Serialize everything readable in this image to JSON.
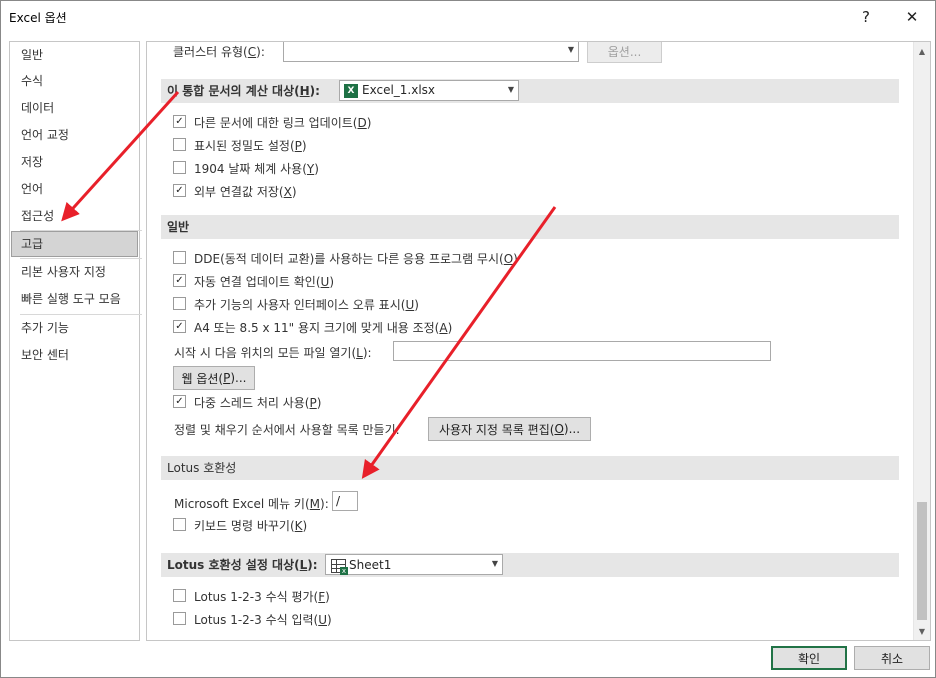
{
  "window": {
    "title": "Excel 옵션",
    "help_glyph": "?",
    "close_glyph": "✕"
  },
  "sidebar": {
    "items": [
      {
        "label": "일반"
      },
      {
        "label": "수식"
      },
      {
        "label": "데이터"
      },
      {
        "label": "언어 교정"
      },
      {
        "label": "저장"
      },
      {
        "label": "언어"
      },
      {
        "label": "접근성"
      },
      {
        "label": "고급",
        "active": true
      },
      {
        "label": "리본 사용자 지정"
      },
      {
        "label": "빠른 실행 도구 모음"
      },
      {
        "label": "추가 기능"
      },
      {
        "label": "보안 센터"
      }
    ]
  },
  "cluster_row": {
    "label": "클러스터 유형(",
    "key": "C",
    "suffix": "):",
    "options_button": "옵션..."
  },
  "calc_section": {
    "header_prefix": "이 통합 문서의 계산 대상(",
    "header_key": "H",
    "header_suffix": "):",
    "workbook": "Excel_1.xlsx",
    "options": [
      {
        "text": "다른 문서에 대한 링크 업데이트(",
        "key": "D",
        "suffix": ")",
        "checked": true
      },
      {
        "text": "표시된 정밀도 설정(",
        "key": "P",
        "suffix": ")",
        "checked": false
      },
      {
        "text": "1904 날짜 체계 사용(",
        "key": "Y",
        "suffix": ")",
        "checked": false
      },
      {
        "text": "외부 연결값 저장(",
        "key": "X",
        "suffix": ")",
        "checked": true
      }
    ]
  },
  "general_section": {
    "header": "일반",
    "options": [
      {
        "text": "DDE(동적 데이터 교환)를 사용하는 다른 응용 프로그램 무시(",
        "key": "O",
        "suffix": ")",
        "checked": false
      },
      {
        "text": "자동 연결 업데이트 확인(",
        "key": "U",
        "suffix": ")",
        "checked": true
      },
      {
        "text": "추가 기능의 사용자 인터페이스 오류 표시(",
        "key": "U",
        "suffix": ")",
        "checked": false
      },
      {
        "text": "A4 또는 8.5 x 11\" 용지 크기에 맞게 내용 조정(",
        "key": "A",
        "suffix": ")",
        "checked": true
      }
    ],
    "startup_label": "시작 시 다음 위치의 모든 파일 열기(",
    "startup_key": "L",
    "startup_suffix": "):",
    "startup_value": "",
    "web_button": "웹 옵션(",
    "web_key": "P",
    "web_suffix": ")...",
    "multithread": {
      "text": "다중 스레드 처리 사용(",
      "key": "P",
      "suffix": ")",
      "checked": true
    },
    "sort_label": "정렬 및 채우기 순서에서 사용할 목록 만들기:",
    "custom_list_button": "사용자 지정 목록 편집(",
    "custom_list_key": "O",
    "custom_list_suffix": ")..."
  },
  "lotus_section": {
    "header": "Lotus 호환성",
    "menu_key_label": "Microsoft Excel 메뉴 키(",
    "menu_key_key": "M",
    "menu_key_suffix": "):",
    "menu_key_value": "/",
    "nav": {
      "text": "키보드 명령 바꾸기(",
      "key": "K",
      "suffix": ")",
      "checked": false
    }
  },
  "lotus_settings": {
    "header_prefix": "Lotus 호환성 설정 대상(",
    "header_key": "L",
    "header_suffix": "):",
    "sheet": "Sheet1",
    "options": [
      {
        "text": "Lotus 1-2-3 수식 평가(",
        "key": "F",
        "suffix": ")",
        "checked": false
      },
      {
        "text": "Lotus 1-2-3 수식 입력(",
        "key": "U",
        "suffix": ")",
        "checked": false
      }
    ]
  },
  "footer": {
    "ok": "확인",
    "cancel": "취소"
  },
  "colors": {
    "annotation_arrow": "#e8202a",
    "section_bg": "#e6e6e6",
    "active_item_bg": "#d4d4d4",
    "excel_green": "#1e7145"
  },
  "icons": {
    "check": "✓",
    "dropdown": "chevron-down-icon",
    "excel_file": "excel-file-icon",
    "sheet": "sheet-icon"
  }
}
